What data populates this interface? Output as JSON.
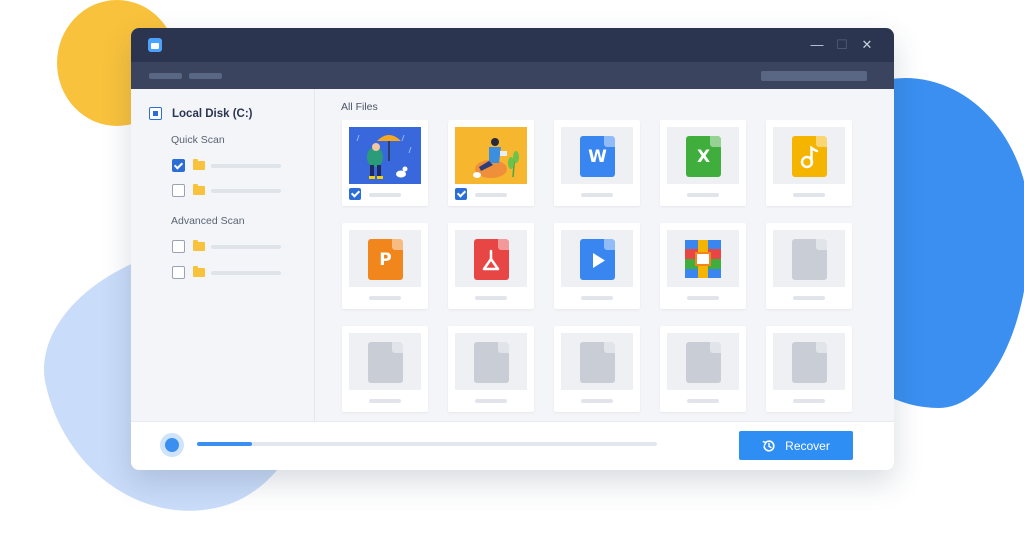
{
  "sidebar": {
    "disk_label": "Local Disk (C:)",
    "quick_scan_label": "Quick Scan",
    "advanced_scan_label": "Advanced Scan",
    "quick_items": [
      {
        "checked": true
      },
      {
        "checked": false
      }
    ],
    "advanced_items": [
      {
        "checked": false
      },
      {
        "checked": false
      }
    ]
  },
  "main": {
    "heading": "All Files",
    "files": [
      {
        "type": "photo-umbrella",
        "checked": true
      },
      {
        "type": "photo-sitting",
        "checked": true
      },
      {
        "type": "word",
        "glyph": "W",
        "color": "#3a86f0"
      },
      {
        "type": "excel",
        "glyph": "X",
        "color": "#3fae3d"
      },
      {
        "type": "audio",
        "color": "#f5b400"
      },
      {
        "type": "powerpoint",
        "glyph": "P",
        "color": "#f0861c"
      },
      {
        "type": "pdf",
        "color": "#e84545"
      },
      {
        "type": "video",
        "color": "#3a86f0"
      },
      {
        "type": "archive"
      },
      {
        "type": "generic"
      },
      {
        "type": "generic"
      },
      {
        "type": "generic"
      },
      {
        "type": "generic"
      },
      {
        "type": "generic"
      },
      {
        "type": "generic"
      }
    ]
  },
  "footer": {
    "progress": 0.12,
    "recover_label": "Recover"
  },
  "colors": {
    "accent": "#2f8ef4",
    "titlebar": "#2b3550",
    "generic_file": "#c9ced6"
  }
}
